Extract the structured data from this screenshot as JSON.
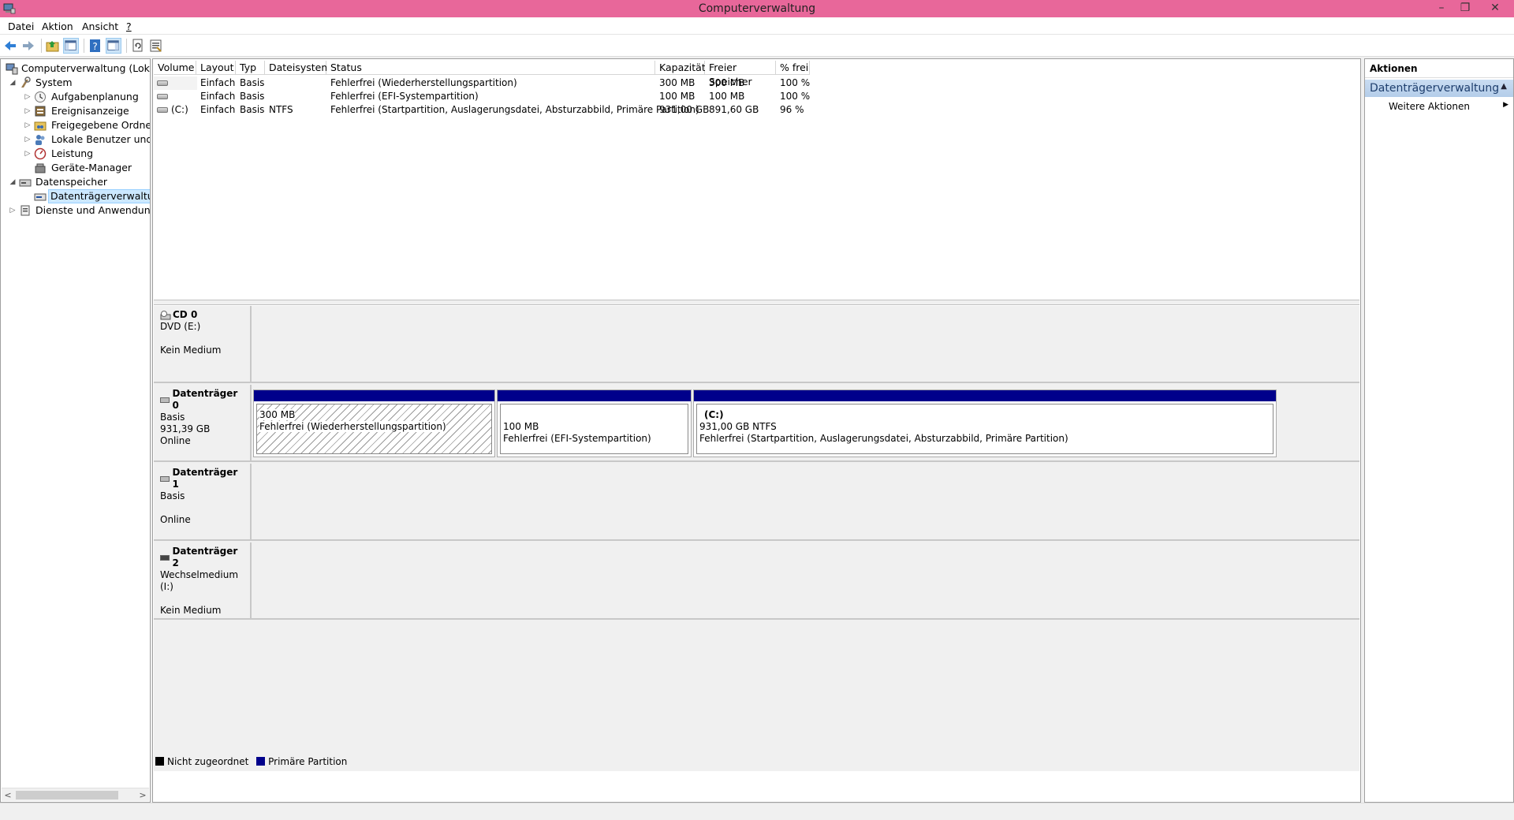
{
  "window": {
    "title": "Computerverwaltung",
    "minimize": "–",
    "restore": "❐",
    "close": "✕"
  },
  "menu": [
    "Datei",
    "Aktion",
    "Ansicht",
    "?"
  ],
  "toolbar": {
    "icons": [
      "back-icon",
      "forward-icon",
      "up-folder-icon",
      "show-hide-tree-icon",
      "help-icon",
      "show-hide-action-pane-icon",
      "refresh-icon",
      "properties-icon"
    ]
  },
  "tree": {
    "items": [
      {
        "label": "Computerverwaltung (Lokal)",
        "expander": ""
      },
      {
        "label": "System",
        "expander": "◢"
      },
      {
        "label": "Aufgabenplanung",
        "expander": "▷"
      },
      {
        "label": "Ereignisanzeige",
        "expander": "▷"
      },
      {
        "label": "Freigegebene Ordner",
        "expander": "▷"
      },
      {
        "label": "Lokale Benutzer und Gr",
        "expander": "▷"
      },
      {
        "label": "Leistung",
        "expander": "▷"
      },
      {
        "label": "Geräte-Manager",
        "expander": ""
      },
      {
        "label": "Datenspeicher",
        "expander": "◢"
      },
      {
        "label": "Datenträgerverwaltung",
        "expander": ""
      },
      {
        "label": "Dienste und Anwendungen",
        "expander": "▷"
      }
    ],
    "scroll_left": "<",
    "scroll_right": ">"
  },
  "volume_table": {
    "columns": [
      "Volume",
      "Layout",
      "Typ",
      "Dateisystem",
      "Status",
      "Kapazität",
      "Freier Speicher",
      "% frei"
    ],
    "rows": [
      [
        "",
        "Einfach",
        "Basis",
        "",
        "Fehlerfrei (Wiederherstellungspartition)",
        "300 MB",
        "300 MB",
        "100 %"
      ],
      [
        "",
        "Einfach",
        "Basis",
        "",
        "Fehlerfrei (EFI-Systempartition)",
        "100 MB",
        "100 MB",
        "100 %"
      ],
      [
        "(C:)",
        "Einfach",
        "Basis",
        "NTFS",
        "Fehlerfrei (Startpartition, Auslagerungsdatei, Absturzabbild, Primäre Partition)",
        "931,00 GB",
        "891,60 GB",
        "96 %"
      ]
    ]
  },
  "disks": [
    {
      "name": "CD 0",
      "line1": "DVD (E:)",
      "line2": "",
      "line3": "Kein Medium"
    },
    {
      "name": "Datenträger 0",
      "line1": "Basis",
      "line2": "931,39 GB",
      "line3": "Online",
      "partitions": [
        {
          "label": "",
          "size": "300 MB",
          "status": "Fehlerfrei (Wiederherstellungspartition)"
        },
        {
          "label": "",
          "size": "100 MB",
          "status": "Fehlerfrei (EFI-Systempartition)"
        },
        {
          "label": "(C:)",
          "size": "931,00 GB NTFS",
          "status": "Fehlerfrei (Startpartition, Auslagerungsdatei, Absturzabbild, Primäre Partition)"
        }
      ]
    },
    {
      "name": "Datenträger 1",
      "line1": "Basis",
      "line2": "",
      "line3": "Online"
    },
    {
      "name": "Datenträger 2",
      "line1": "Wechselmedium (I:)",
      "line2": "",
      "line3": "Kein Medium"
    }
  ],
  "legend": {
    "unallocated": "Nicht zugeordnet",
    "primary": "Primäre Partition",
    "unallocated_color": "#000000",
    "primary_color": "#00008b"
  },
  "actions": {
    "title": "Aktionen",
    "section": "Datenträgerverwaltung",
    "more": "Weitere Aktionen"
  }
}
